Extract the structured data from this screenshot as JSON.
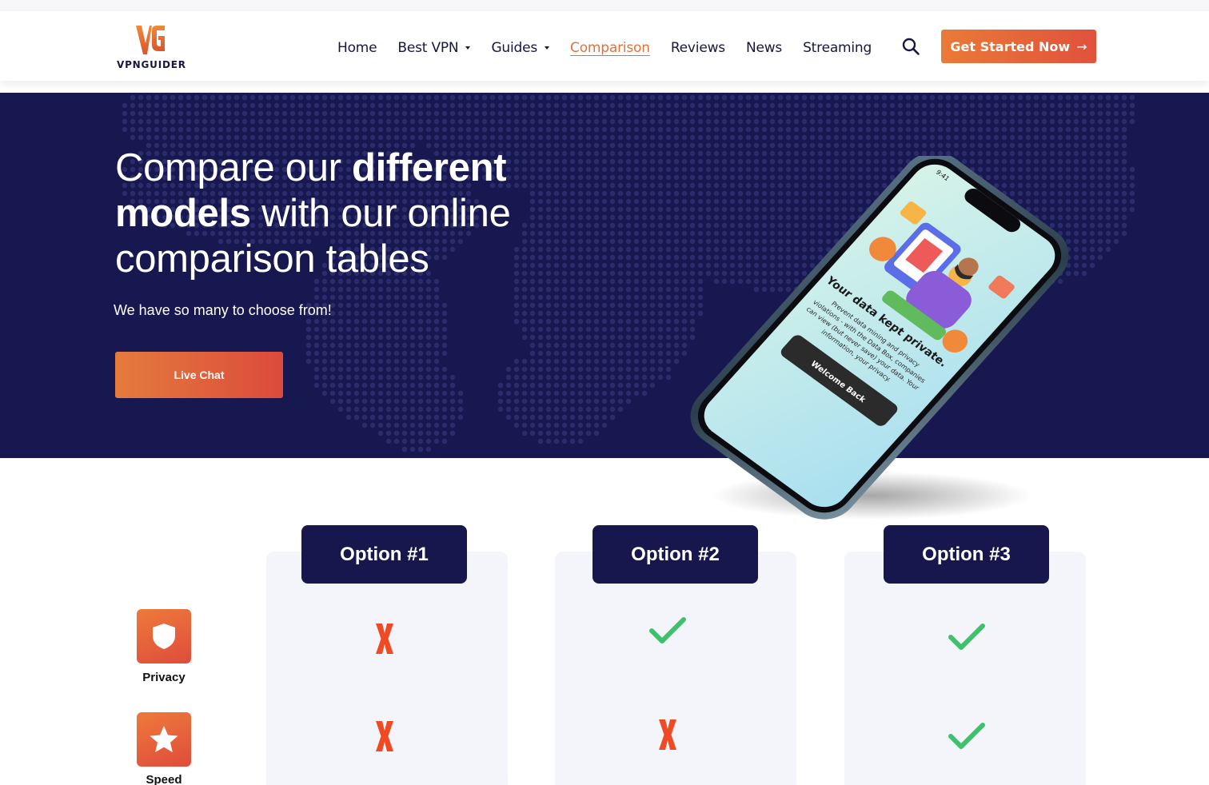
{
  "header": {
    "logo_text": "VPNGUIDER",
    "nav": [
      {
        "label": "Home",
        "dropdown": false,
        "active": false
      },
      {
        "label": "Best VPN",
        "dropdown": true,
        "active": false
      },
      {
        "label": "Guides",
        "dropdown": true,
        "active": false
      },
      {
        "label": "Comparison",
        "dropdown": false,
        "active": true
      },
      {
        "label": "Reviews",
        "dropdown": false,
        "active": false
      },
      {
        "label": "News",
        "dropdown": false,
        "active": false
      },
      {
        "label": "Streaming",
        "dropdown": false,
        "active": false
      }
    ],
    "cta_label": "Get Started Now",
    "cta_arrow": "→"
  },
  "hero": {
    "title_part1": "Compare our ",
    "title_bold1": "different",
    "title_bold2": "models",
    "title_part2": " with our online comparison tables",
    "subtitle": "We have so many to choose from!",
    "button_label": "Live Chat"
  },
  "phone": {
    "time": "9:41",
    "heading": "Your data kept private.",
    "body_lines": [
      "Prevent data mining and privacy",
      "violations - with the Data Box, companies",
      "can view (but never save) your data. Your",
      "information, your privacy."
    ],
    "button": "Welcome Back"
  },
  "comparison": {
    "options": [
      "Option #1",
      "Option #2",
      "Option #3"
    ],
    "features": [
      {
        "label": "Privacy",
        "icon": "shield-icon",
        "values": [
          false,
          true,
          true
        ]
      },
      {
        "label": "Speed",
        "icon": "star-icon",
        "values": [
          false,
          false,
          true
        ]
      }
    ]
  },
  "colors": {
    "navy": "#17174d",
    "accent": "#e0723a",
    "check": "#3fc06d",
    "cross": "#f04a24"
  }
}
